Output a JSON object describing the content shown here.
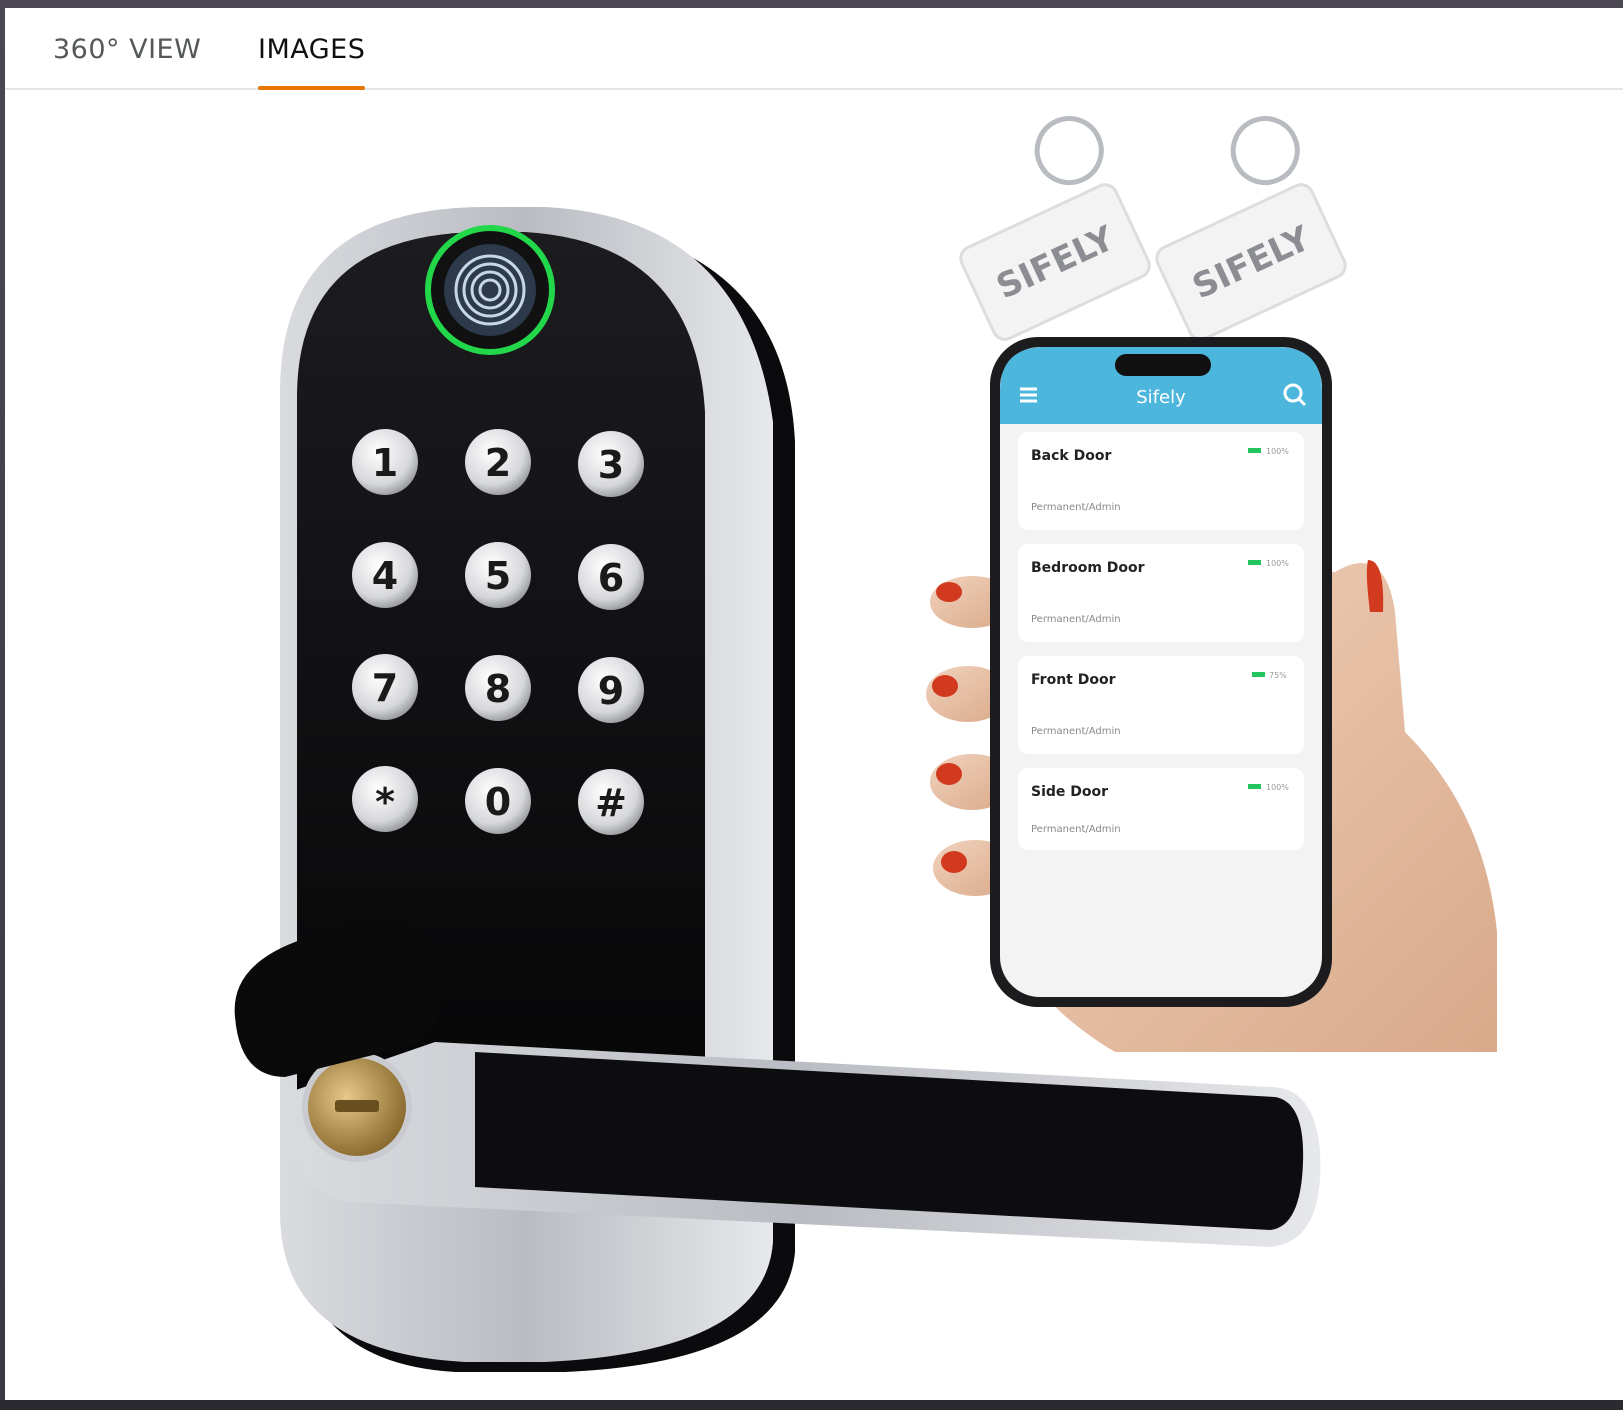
{
  "tabs": [
    {
      "label": "360° VIEW",
      "active": false
    },
    {
      "label": "IMAGES",
      "active": true
    }
  ],
  "product": {
    "keypad_keys": [
      "1",
      "2",
      "3",
      "4",
      "5",
      "6",
      "7",
      "8",
      "9",
      "*",
      "0",
      "#"
    ],
    "key_fob_brand": "SIFELY"
  },
  "phone_app": {
    "title": "Sifely",
    "locks": [
      {
        "name": "Back Door",
        "role": "Permanent/Admin",
        "battery": "100%"
      },
      {
        "name": "Bedroom Door",
        "role": "Permanent/Admin",
        "battery": "100%"
      },
      {
        "name": "Front Door",
        "role": "Permanent/Admin",
        "battery": "75%"
      },
      {
        "name": "Side Door",
        "role": "Permanent/Admin",
        "battery": "100%"
      }
    ]
  },
  "colors": {
    "tab_underline": "#e77600",
    "app_header": "#4db6dc",
    "fingerprint_ring": "#22d84a",
    "battery": "#22c55e"
  }
}
